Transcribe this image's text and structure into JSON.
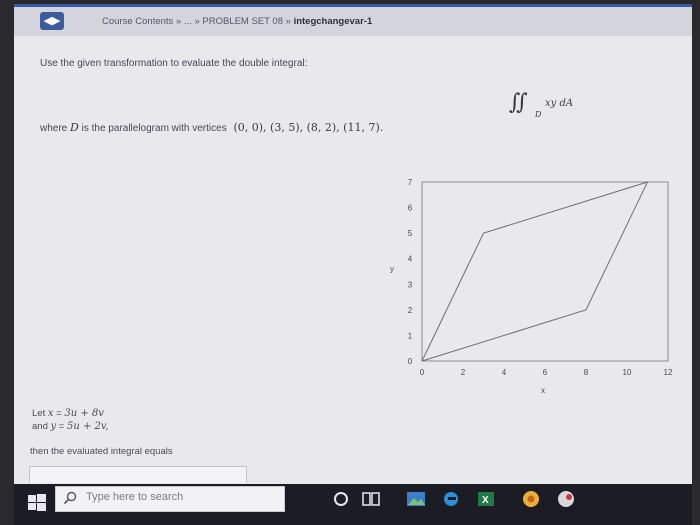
{
  "breadcrumb": {
    "course_contents": "Course Contents",
    "sep1": "»",
    "ellipsis": "...",
    "sep2": "»",
    "problem_set": "PROBLEM SET 08",
    "sep3": "»",
    "current": "integchangevar-1"
  },
  "problem": {
    "instruction": "Use the given transformation to evaluate the double integral:",
    "integrand": "xy dA",
    "region": "D",
    "where_prefix": "where",
    "where_suffix": "is the parallelogram with vertices",
    "vertices_text": "(0, 0),  (3, 5),  (8, 2),  (11, 7)."
  },
  "chart_data": {
    "type": "line",
    "xlabel": "x",
    "ylabel": "y",
    "xlim": [
      0,
      12
    ],
    "ylim": [
      0,
      7
    ],
    "xticks": [
      0,
      2,
      4,
      6,
      8,
      10,
      12
    ],
    "yticks": [
      0,
      1,
      2,
      3,
      4,
      5,
      6,
      7
    ],
    "series": [
      {
        "x": [
          0,
          3,
          11,
          8,
          0
        ],
        "y": [
          0,
          5,
          7,
          2,
          0
        ]
      }
    ]
  },
  "transformation": {
    "let": "Let",
    "x_var": "x",
    "eq": "=",
    "x_expr": "3u + 8v",
    "and": "and",
    "y_var": "y",
    "y_expr": "5u + 2v,"
  },
  "result_text": "then the evaluated integral equals",
  "answer": {
    "value": ""
  },
  "taskbar": {
    "search_placeholder": "Type here to search"
  }
}
